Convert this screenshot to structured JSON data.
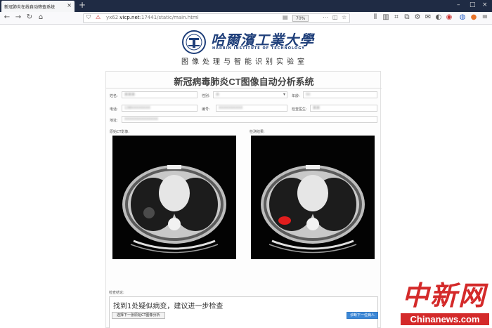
{
  "browser": {
    "tab_title": "新冠肺炎在线自动筛查系统",
    "url_prefix": "yx62.",
    "url_host": "vicp.net",
    "url_path": ":17441/static/main.html",
    "zoom": "70%",
    "icons": [
      "back-icon",
      "forward-icon",
      "reload-icon",
      "home-icon",
      "shield-icon",
      "insecure-icon",
      "menu-dots-icon",
      "star-icon",
      "library-icon",
      "sidebar-icon",
      "screenshot-icon",
      "extension-icon",
      "translate-icon",
      "user-icon",
      "hamburger-icon"
    ]
  },
  "header": {
    "school_cn": "哈爾濱工業大學",
    "school_en": "HARBIN INSTITUTE OF TECHNOLOGY",
    "lab_name": "图像处理与智能识别实验室"
  },
  "system": {
    "title": "新冠病毒肺炎CT图像自动分析系统"
  },
  "form": {
    "name_label": "姓名:",
    "name_value": "某某某",
    "gender_label": "性别:",
    "gender_value": "男",
    "age_label": "年龄:",
    "age_value": "50",
    "phone_label": "电话:",
    "phone_value": "138XXXXXXXX",
    "id_label": "编号:",
    "id_value": "XXXXXXXXXX",
    "doctor_label": "检查医生:",
    "doctor_value": "某某",
    "address_label": "地址:",
    "address_value": "XXXXXXXXXXXXXX"
  },
  "images": {
    "original_label": "原始CT影像:",
    "result_label": "检测结果:"
  },
  "result": {
    "label": "检查结论:",
    "text": "找到1处疑似病变，建议进一步检查"
  },
  "buttons": {
    "upload": "选择下一张原始CT图像分析",
    "next": "诊断下一位病人"
  },
  "watermark": {
    "cn": "中新网",
    "en": "Chinanews.com"
  },
  "colors": {
    "accent": "#3c87d6",
    "brand_blue": "#1f3f7a",
    "lesion": "#e11d1d",
    "watermark_red": "#d42a2a"
  }
}
